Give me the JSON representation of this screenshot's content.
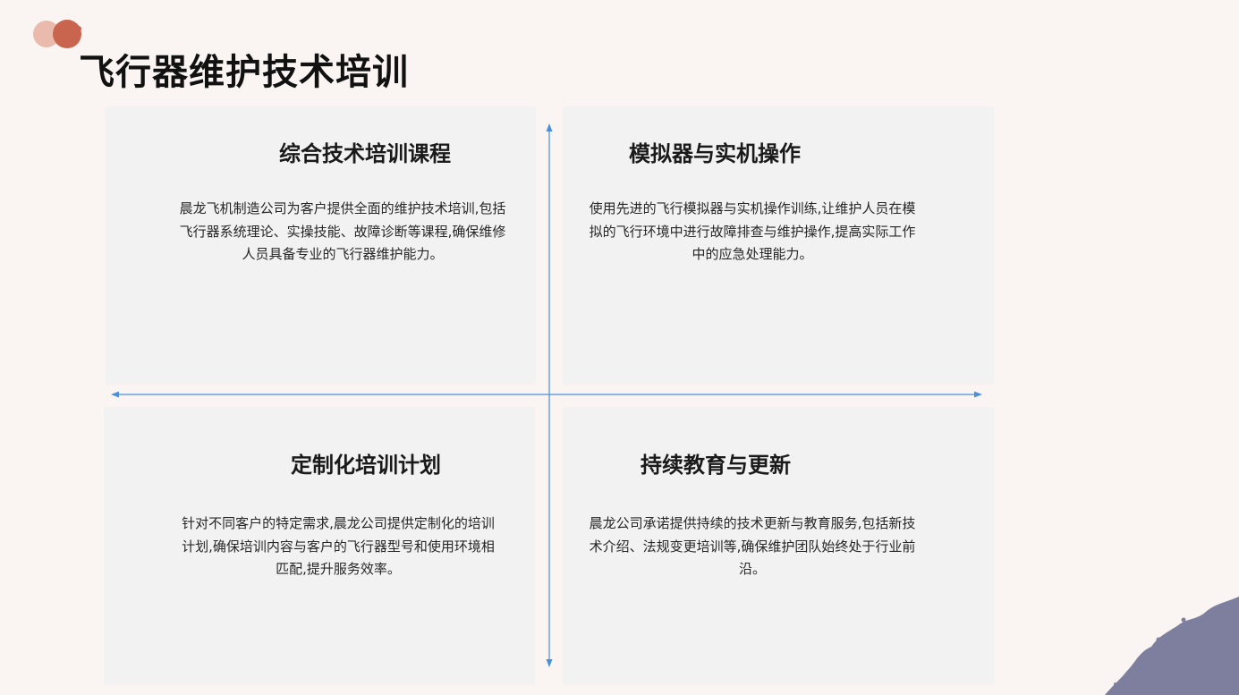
{
  "slide": {
    "title": "飞行器维护技术培训",
    "quadrants": [
      {
        "heading": "综合技术培训课程",
        "body": "晨龙飞机制造公司为客户提供全面的维护技术培训,包括飞行器系统理论、实操技能、故障诊断等课程,确保维修人员具备专业的飞行器维护能力。"
      },
      {
        "heading": "模拟器与实机操作",
        "body": "使用先进的飞行模拟器与实机操作训练,让维护人员在模拟的飞行环境中进行故障排查与维护操作,提高实际工作中的应急处理能力。"
      },
      {
        "heading": "定制化培训计划",
        "body": "针对不同客户的特定需求,晨龙公司提供定制化的培训计划,确保培训内容与客户的飞行器型号和使用环境相匹配,提升服务效率。"
      },
      {
        "heading": "持续教育与更新",
        "body": "晨龙公司承诺提供持续的技术更新与教育服务,包括新技术介绍、法规变更培训等,确保维护团队始终处于行业前沿。"
      }
    ]
  },
  "colors": {
    "background": "#faf5f2",
    "panel": "#f2f2f2",
    "axis": "#4a90d9",
    "deco_light": "#e8b5a5",
    "deco_dark": "#c9654f",
    "deco_corner": "#7e7f9e"
  }
}
